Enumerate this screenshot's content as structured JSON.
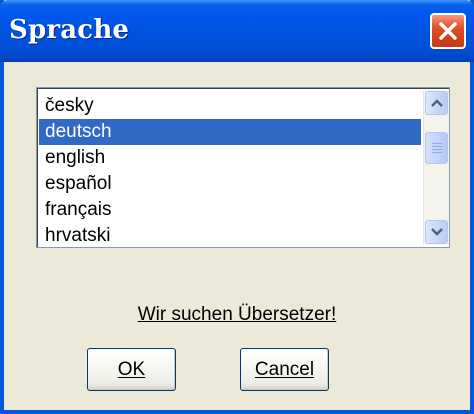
{
  "window": {
    "title": "Sprache",
    "close_icon": "close-icon"
  },
  "language_list": {
    "items": [
      "česky",
      "deutsch",
      "english",
      "español",
      "français",
      "hrvatski"
    ],
    "selected": "deutsch",
    "scrollbar": {
      "up_icon": "chevron-up-icon",
      "down_icon": "chevron-down-icon"
    }
  },
  "link": {
    "text": "Wir suchen Übersetzer!"
  },
  "buttons": {
    "ok_label": "OK",
    "cancel_label": "Cancel"
  },
  "colors": {
    "titlebar": "#0054e3",
    "selection": "#316ac5",
    "close_button": "#e0502a",
    "dialog_background": "#ece9d8"
  }
}
